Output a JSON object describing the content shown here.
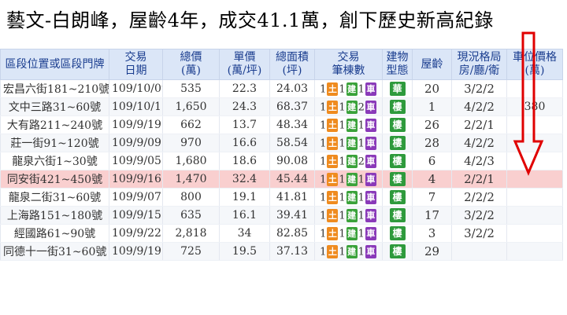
{
  "headline": "藝文-白朗峰，屋齡4年，成交41.1萬，創下歷史新高紀錄",
  "colors": {
    "header_bg": "#dbe6f7",
    "header_text": "#1a3d8f",
    "address": "#c07a00",
    "highlight_row": "#f9cfcf",
    "arrow": "#e00000"
  },
  "columns": {
    "address": "區段位置或區段門牌",
    "date_1": "交易",
    "date_2": "日期",
    "total_1": "總價",
    "total_2": "(萬)",
    "unit_1": "單價",
    "unit_2": "(萬/坪)",
    "area_1": "總面積",
    "area_2": "(坪)",
    "count_1": "交易",
    "count_2": "筆棟數",
    "type_1": "建物",
    "type_2": "型態",
    "age": "屋齡",
    "layout_1": "現況格局",
    "layout_2": "房/廳/衛",
    "parking_1": "車位價格",
    "parking_2": "(萬)"
  },
  "badges": {
    "land": "土",
    "building": "建",
    "parking": "車"
  },
  "rows": [
    {
      "address": "宏昌六街181~210號",
      "date": "109/10/09",
      "total": "535",
      "unit": "22.3",
      "area": "24.03",
      "land": "1",
      "bldg": "1",
      "park": "1",
      "type": "華",
      "age": "20",
      "layout": "3/2/2",
      "parking": ""
    },
    {
      "address": "文中三路31~60號",
      "date": "109/10/11",
      "total": "1,650",
      "unit": "24.3",
      "area": "68.37",
      "land": "1",
      "bldg": "1",
      "park": "2",
      "type": "樓",
      "age": "1",
      "layout": "4/2/2",
      "parking": "380"
    },
    {
      "address": "大有路211~240號",
      "date": "109/9/19",
      "total": "662",
      "unit": "13.7",
      "area": "48.34",
      "land": "1",
      "bldg": "1",
      "park": "1",
      "type": "樓",
      "age": "26",
      "layout": "2/2/1",
      "parking": ""
    },
    {
      "address": "莊一街91~120號",
      "date": "109/9/09",
      "total": "970",
      "unit": "16.6",
      "area": "58.54",
      "land": "1",
      "bldg": "1",
      "park": "1",
      "type": "樓",
      "age": "28",
      "layout": "4/2/2",
      "parking": ""
    },
    {
      "address": "龍泉六街1~30號",
      "date": "109/9/05",
      "total": "1,680",
      "unit": "18.6",
      "area": "90.08",
      "land": "1",
      "bldg": "1",
      "park": "2",
      "type": "樓",
      "age": "6",
      "layout": "4/2/3",
      "parking": ""
    },
    {
      "address": "同安街421~450號",
      "date": "109/9/16",
      "total": "1,470",
      "unit": "32.4",
      "area": "45.44",
      "land": "1",
      "bldg": "1",
      "park": "1",
      "type": "樓",
      "age": "4",
      "layout": "2/2/1",
      "parking": ""
    },
    {
      "address": "龍泉二街31~60號",
      "date": "109/9/07",
      "total": "800",
      "unit": "19.1",
      "area": "41.81",
      "land": "1",
      "bldg": "1",
      "park": "1",
      "type": "樓",
      "age": "7",
      "layout": "2/2/2",
      "parking": ""
    },
    {
      "address": "上海路151~180號",
      "date": "109/9/15",
      "total": "635",
      "unit": "16.1",
      "area": "39.41",
      "land": "1",
      "bldg": "1",
      "park": "1",
      "type": "樓",
      "age": "17",
      "layout": "3/2/2",
      "parking": ""
    },
    {
      "address": "經國路61~90號",
      "date": "109/9/22",
      "total": "2,818",
      "unit": "34",
      "area": "82.85",
      "land": "1",
      "bldg": "1",
      "park": "1",
      "type": "樓",
      "age": "3",
      "layout": "3/2/2",
      "parking": ""
    },
    {
      "address": "同德十一街31~60號",
      "date": "109/9/19",
      "total": "725",
      "unit": "19.5",
      "area": "37.13",
      "land": "1",
      "bldg": "1",
      "park": "1",
      "type": "樓",
      "age": "29",
      "layout": "",
      "parking": ""
    }
  ]
}
